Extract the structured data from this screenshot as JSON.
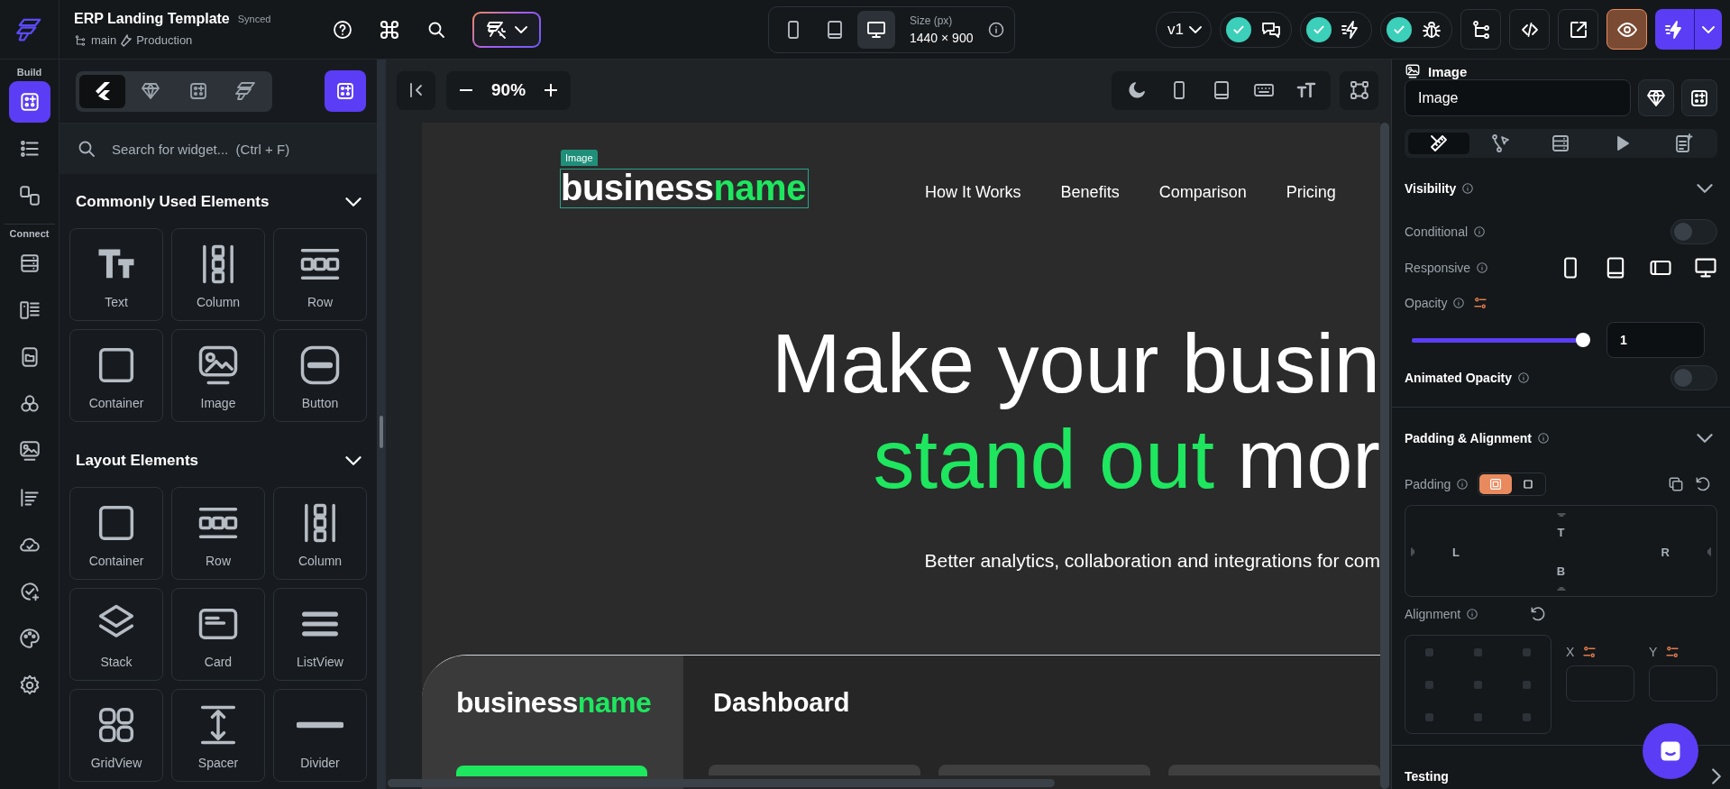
{
  "app": {
    "title": "ERP Landing Template",
    "sync_status": "Synced",
    "branch": "main",
    "environment": "Production"
  },
  "devices": [
    {
      "selected": false
    },
    {
      "selected": false
    },
    {
      "selected": true
    }
  ],
  "canvas_size": {
    "label": "Size (px)",
    "value": "1440 × 900"
  },
  "version": "v1",
  "status_checks": [
    {
      "passed": true
    },
    {
      "passed": true
    },
    {
      "passed": true
    }
  ],
  "rail": [
    {
      "label": "Build",
      "items": [
        {
          "selected": true
        },
        {
          "selected": false
        },
        {
          "selected": false
        }
      ]
    },
    {
      "label": "Connect",
      "items": [
        {
          "selected": false
        },
        {
          "selected": false
        },
        {
          "selected": false
        },
        {
          "selected": false
        },
        {
          "selected": false
        },
        {
          "selected": false
        },
        {
          "selected": false
        },
        {
          "selected": false
        },
        {
          "selected": false
        },
        {
          "selected": false
        }
      ]
    }
  ],
  "widget_panel": {
    "tabs": [
      {
        "selected": true
      },
      {
        "selected": false
      },
      {
        "selected": false
      },
      {
        "selected": false
      }
    ],
    "search": {
      "placeholder": "Search for widget...  (Ctrl + F)"
    },
    "sections": [
      {
        "title": "Commonly Used Elements",
        "expanded": true,
        "widgets": [
          "Text",
          "Column",
          "Row",
          "Container",
          "Image",
          "Button"
        ]
      },
      {
        "title": "Layout Elements",
        "expanded": true,
        "widgets": [
          "Container",
          "Row",
          "Column",
          "Stack",
          "Card",
          "ListView",
          "GridView",
          "Spacer",
          "Divider"
        ]
      }
    ]
  },
  "canvas": {
    "zoom": "90%"
  },
  "preview": {
    "selected_tag": "Image",
    "logo": {
      "lead": "business",
      "accent": "name"
    },
    "nav_links": [
      "How It Works",
      "Benefits",
      "Comparison",
      "Pricing"
    ],
    "headline": {
      "line_1": "Make your busin",
      "line_2_accent": "stand out",
      "line_2_rest": "mor"
    },
    "subtitle": "Better analytics, collaboration and integrations for com",
    "dashboard": {
      "logo": {
        "lead": "business",
        "accent": "name"
      },
      "title": "Dashboard"
    }
  },
  "properties": {
    "widget_type": "Image",
    "name_field": {
      "value": "Image"
    },
    "tabs": [
      {
        "selected": true
      },
      {
        "selected": false
      },
      {
        "selected": false
      },
      {
        "selected": false
      },
      {
        "selected": false
      }
    ],
    "visibility": {
      "title": "Visibility",
      "expanded": true,
      "conditional": {
        "label": "Conditional",
        "on": false
      },
      "responsive": {
        "label": "Responsive",
        "devices": [
          {
            "on": true
          },
          {
            "on": true
          },
          {
            "on": true
          },
          {
            "on": true
          }
        ]
      },
      "opacity": {
        "label": "Opacity",
        "level": 1,
        "value": "1"
      },
      "animated_opacity": {
        "label": "Animated Opacity",
        "on": false
      }
    },
    "padding_alignment": {
      "title": "Padding & Alignment",
      "expanded": true,
      "padding": {
        "label": "Padding",
        "modes": [
          {
            "selected": true
          },
          {
            "selected": false
          }
        ],
        "top": "T",
        "left": "L",
        "right": "R",
        "bottom": "B"
      },
      "alignment": {
        "label": "Alignment",
        "x_label": "X",
        "y_label": "Y"
      }
    },
    "testing": {
      "title": "Testing",
      "expanded": false
    }
  }
}
